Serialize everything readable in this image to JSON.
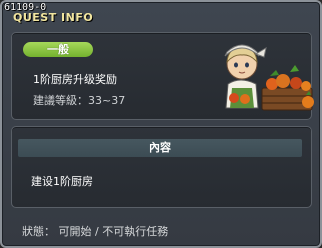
{
  "window": {
    "quest_id": "61109-0",
    "title": "QUEST INFO"
  },
  "quest": {
    "badge": "一般",
    "badge_color": "#8cc644",
    "name": "1阶厨房升级奖励",
    "level_requirement": "建議等級：33~37"
  },
  "npc": {
    "icon": "chef-npc-with-vegetable-crate"
  },
  "content": {
    "header": "內容",
    "text": "建设1阶厨房"
  },
  "status": {
    "text": "狀態： 可開始 / 不可執行任務"
  }
}
